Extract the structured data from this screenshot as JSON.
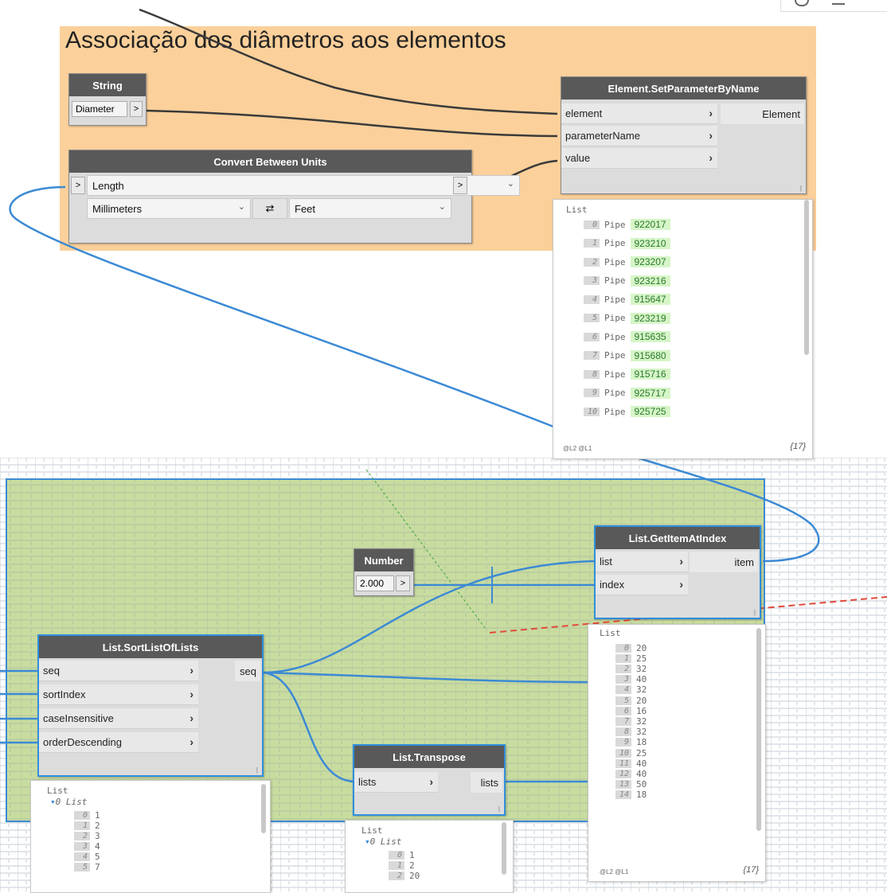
{
  "group": {
    "title": "Associação dos diâmetros aos elementos",
    "color": "#fbd09a"
  },
  "nodes": {
    "string": {
      "title": "String",
      "value": "Diameter",
      "out_btn": ">"
    },
    "set_param": {
      "title": "Element.SetParameterByName",
      "in1": "element",
      "in2": "parameterName",
      "in3": "value",
      "out1": "Element"
    },
    "convert": {
      "title": "Convert Between Units",
      "in_btn": ">",
      "out_btn": ">",
      "conversion": "Length",
      "from_unit": "Millimeters",
      "swap": "⇄",
      "to_unit": "Feet"
    },
    "number": {
      "title": "Number",
      "value": "2.000",
      "out_btn": ">"
    },
    "get_item": {
      "title": "List.GetItemAtIndex",
      "in1": "list",
      "in2": "index",
      "out1": "item"
    },
    "sort": {
      "title": "List.SortListOfLists",
      "in1": "seq",
      "in2": "sortIndex",
      "in3": "caseInsensitive",
      "in4": "orderDescending",
      "out1": "seq"
    },
    "transpose": {
      "title": "List.Transpose",
      "in1": "lists",
      "out1": "lists"
    }
  },
  "previews": {
    "pipes": {
      "label": "List",
      "items": [
        {
          "i": "0",
          "t": "Pipe",
          "v": "922017"
        },
        {
          "i": "1",
          "t": "Pipe",
          "v": "923210"
        },
        {
          "i": "2",
          "t": "Pipe",
          "v": "923207"
        },
        {
          "i": "3",
          "t": "Pipe",
          "v": "923216"
        },
        {
          "i": "4",
          "t": "Pipe",
          "v": "915647"
        },
        {
          "i": "5",
          "t": "Pipe",
          "v": "923219"
        },
        {
          "i": "6",
          "t": "Pipe",
          "v": "915635"
        },
        {
          "i": "7",
          "t": "Pipe",
          "v": "915680"
        },
        {
          "i": "8",
          "t": "Pipe",
          "v": "915716"
        },
        {
          "i": "9",
          "t": "Pipe",
          "v": "925717"
        },
        {
          "i": "10",
          "t": "Pipe",
          "v": "925725"
        }
      ],
      "levels": "@L2 @L1",
      "count": "{17}"
    },
    "diameters": {
      "label": "List",
      "items": [
        {
          "i": "0",
          "v": "20"
        },
        {
          "i": "1",
          "v": "25"
        },
        {
          "i": "2",
          "v": "32"
        },
        {
          "i": "3",
          "v": "40"
        },
        {
          "i": "4",
          "v": "32"
        },
        {
          "i": "5",
          "v": "20"
        },
        {
          "i": "6",
          "v": "16"
        },
        {
          "i": "7",
          "v": "32"
        },
        {
          "i": "8",
          "v": "32"
        },
        {
          "i": "9",
          "v": "18"
        },
        {
          "i": "10",
          "v": "25"
        },
        {
          "i": "11",
          "v": "40"
        },
        {
          "i": "12",
          "v": "40"
        },
        {
          "i": "13",
          "v": "50"
        },
        {
          "i": "14",
          "v": "18"
        }
      ],
      "levels": "@L2 @L1",
      "count": "{17}"
    },
    "sorted": {
      "label": "List",
      "sub": "0 List",
      "items": [
        {
          "i": "0",
          "v": "1"
        },
        {
          "i": "1",
          "v": "2"
        },
        {
          "i": "2",
          "v": "3"
        },
        {
          "i": "3",
          "v": "4"
        },
        {
          "i": "4",
          "v": "5"
        },
        {
          "i": "5",
          "v": "7"
        }
      ]
    },
    "transposed": {
      "label": "List",
      "sub": "0 List",
      "items": [
        {
          "i": "0",
          "v": "1"
        },
        {
          "i": "1",
          "v": "2"
        },
        {
          "i": "2",
          "v": "20"
        }
      ]
    }
  },
  "colors": {
    "wire_dark": "#3a3a3a",
    "wire_blue": "#3c8ad4",
    "group_green": "#c9dca0",
    "node_header": "#595959"
  }
}
